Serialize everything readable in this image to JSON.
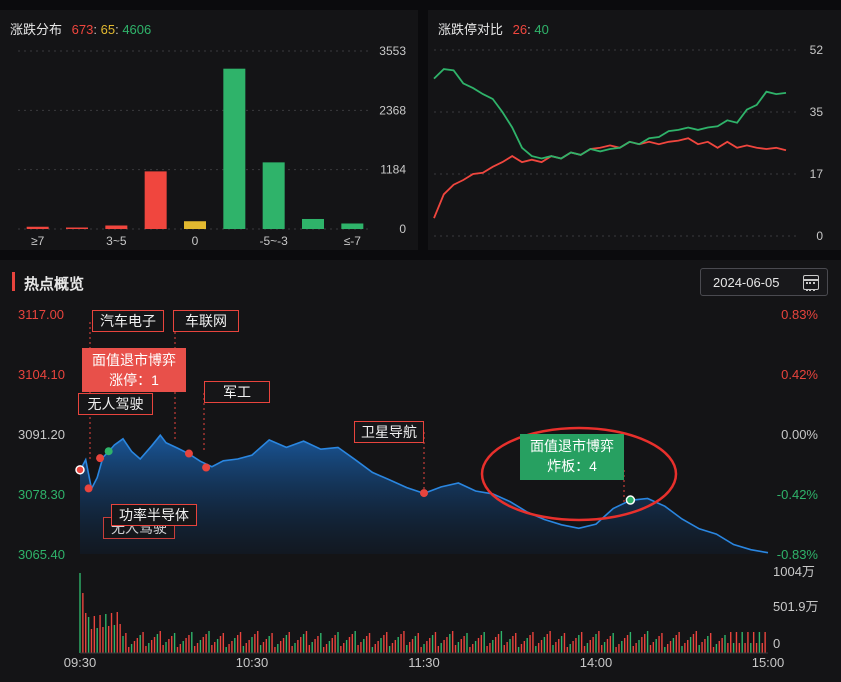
{
  "distribution": {
    "title": "涨跌分布",
    "up": "673",
    "flat": "65",
    "down": "4606",
    "sep": ":"
  },
  "ratio": {
    "title": "涨跌停对比",
    "limit_up": "26",
    "limit_down": "40",
    "sep": ":"
  },
  "hot": {
    "title": "热点概览",
    "date": "2024-06-05",
    "calendar_icon": "calendar-icon"
  },
  "colors": {
    "up": "#f0463e",
    "down": "#2fb36a",
    "flat": "#e2b930",
    "line": "#1f7ed8"
  },
  "chart_data": [
    {
      "type": "bar",
      "title": "涨跌分布",
      "categories": [
        "≥7",
        "",
        "3~5",
        "",
        "0",
        "",
        "-5~-3",
        "",
        "≤-7"
      ],
      "category_colors": [
        "up",
        "up",
        "up",
        "up",
        "flat",
        "down",
        "down",
        "down",
        "down"
      ],
      "values": [
        45,
        30,
        70,
        1150,
        155,
        3200,
        1330,
        200,
        110
      ],
      "yticks": [
        "3553",
        "2368",
        "1184",
        "0"
      ],
      "ylim": [
        0,
        3553
      ]
    },
    {
      "type": "line",
      "title": "涨跌停对比",
      "yticks": [
        "52",
        "35",
        "17",
        "0"
      ],
      "ylim": [
        0,
        52
      ],
      "series": [
        {
          "color": "up",
          "values": [
            5,
            12,
            14,
            16,
            17,
            18,
            19,
            21,
            22,
            21,
            21,
            21,
            22,
            22,
            23,
            23,
            24,
            25,
            25,
            25,
            26,
            26,
            26,
            26,
            26,
            27,
            27,
            26,
            26,
            25,
            26,
            25,
            25,
            25,
            24,
            25,
            24
          ]
        },
        {
          "color": "down",
          "values": [
            44,
            47,
            46,
            43,
            41,
            40,
            38,
            35,
            30,
            25,
            22,
            22,
            22,
            22,
            23,
            23,
            24,
            24,
            24,
            25,
            26,
            26,
            27,
            28,
            29,
            30,
            30,
            30,
            30,
            31,
            32,
            32,
            35,
            37,
            40,
            40,
            40
          ]
        }
      ]
    },
    {
      "type": "line",
      "title": "热点概览",
      "y_left_ticks": [
        "3117.00",
        "3104.10",
        "3091.20",
        "3078.30",
        "3065.40"
      ],
      "y_right_ticks": [
        "0.83%",
        "0.42%",
        "0.00%",
        "-0.42%",
        "-0.83%"
      ],
      "ylim": [
        3065.4,
        3117.0
      ],
      "volume_ticks": [
        "1004万",
        "501.9万",
        "0"
      ],
      "x_ticks": [
        "09:30",
        "10:30",
        "11:30",
        "14:00",
        "15:00"
      ],
      "x": [
        0,
        2,
        4,
        6,
        8,
        10,
        12,
        15,
        18,
        21,
        25,
        28,
        30,
        34,
        38,
        42,
        46,
        50,
        55,
        60,
        66,
        72,
        78,
        84,
        90,
        96,
        102,
        108,
        114,
        120,
        126,
        132,
        138,
        144,
        150,
        156,
        162,
        168,
        174,
        180,
        186,
        192,
        198,
        204,
        210,
        216,
        222,
        228,
        234,
        240
      ],
      "values": [
        3083.5,
        3085.5,
        3079.5,
        3082.0,
        3086.0,
        3087.5,
        3089.0,
        3090.0,
        3087.5,
        3086.0,
        3088.5,
        3091.0,
        3089.5,
        3088.0,
        3087.0,
        3085.5,
        3084.0,
        3085.5,
        3086.0,
        3086.5,
        3090.0,
        3088.5,
        3089.5,
        3088.0,
        3088.5,
        3085.5,
        3083.0,
        3081.5,
        3079.5,
        3078.5,
        3080.0,
        3080.5,
        3079.0,
        3078.5,
        3076.5,
        3074.5,
        3073.0,
        3071.5,
        3071.0,
        3072.0,
        3075.0,
        3077.0,
        3077.5,
        3075.5,
        3073.0,
        3071.0,
        3069.5,
        3067.5,
        3066.5,
        3065.5
      ],
      "events": [
        {
          "label": "汽车电子",
          "idx": 10
        },
        {
          "label": "车联网",
          "idx": 29
        },
        {
          "label": "面值退市博弈\n涨停：1",
          "idx": 0,
          "kind": "up"
        },
        {
          "label": "无人驾驶",
          "idx": 3
        },
        {
          "label": "军工",
          "idx": 38
        },
        {
          "label": "卫星导航",
          "idx": 109
        },
        {
          "label": "功率半导体",
          "idx": 7
        },
        {
          "label": "面值退市博弈\n炸板：4",
          "idx": 162,
          "kind": "down"
        }
      ]
    }
  ],
  "labels": {
    "ev_car_electronics": "汽车电子",
    "ev_car_network": "车联网",
    "ev_delist_up_1": "面值退市博弈",
    "ev_delist_up_2": "涨停：1",
    "ev_autonomous": "无人驾驶",
    "ev_autonomous_2": "无人驾驶",
    "ev_military": "军工",
    "ev_satnav": "卫星导航",
    "ev_power_semi": "功率半导体",
    "ev_delist_down_1": "面值退市博弈",
    "ev_delist_down_2": "炸板：4"
  }
}
